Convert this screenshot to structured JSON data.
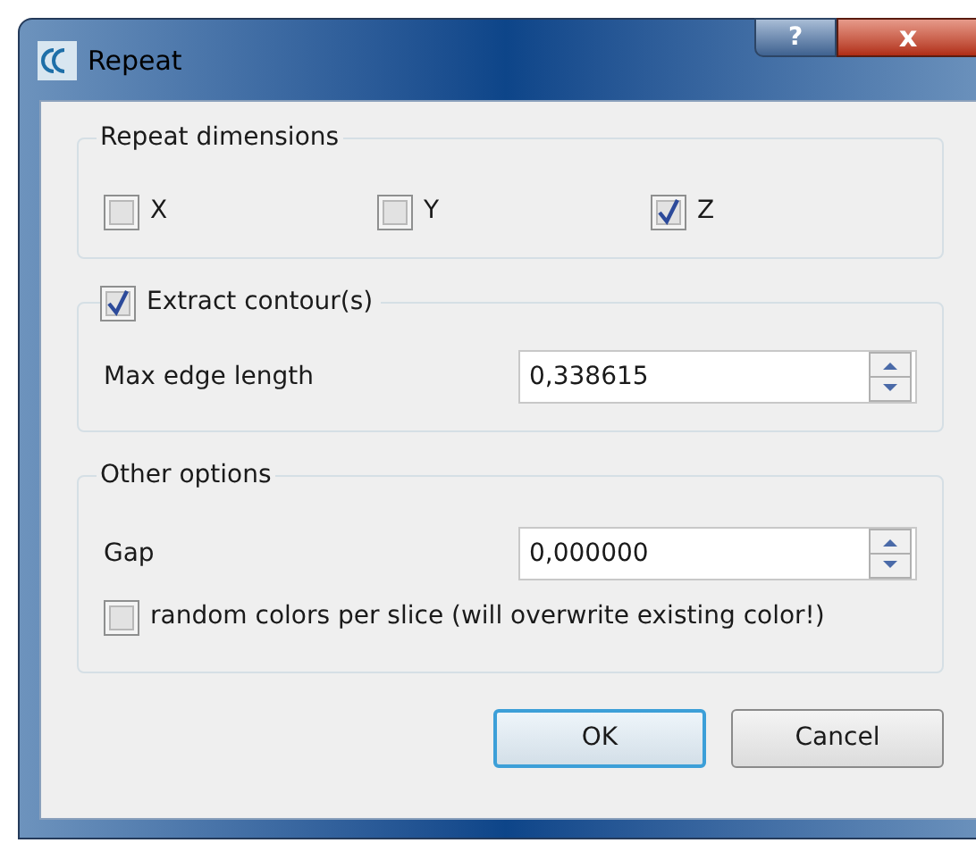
{
  "window": {
    "title": "Repeat",
    "help_button": "?",
    "close_button": "x"
  },
  "repeat_dimensions": {
    "title": "Repeat dimensions",
    "axes": [
      {
        "label": "X",
        "checked": false
      },
      {
        "label": "Y",
        "checked": false
      },
      {
        "label": "Z",
        "checked": true
      }
    ]
  },
  "extract_contours": {
    "label": "Extract contour(s)",
    "checked": true,
    "fields": [
      {
        "label": "Max edge length",
        "value": "0,338615"
      }
    ]
  },
  "other_options": {
    "title": "Other options",
    "fields": [
      {
        "label": "Gap",
        "value": "0,000000"
      }
    ],
    "random_colors": {
      "label": "random colors per slice (will overwrite existing color!)",
      "checked": false
    }
  },
  "buttons": [
    {
      "label": "OK",
      "default": true
    },
    {
      "label": "Cancel",
      "default": false
    }
  ]
}
